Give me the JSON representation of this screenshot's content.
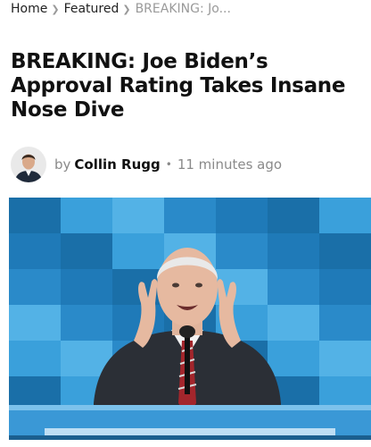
{
  "breadcrumb": {
    "items": [
      {
        "label": "Home"
      },
      {
        "label": "Featured"
      }
    ],
    "current": "BREAKING: Jo..."
  },
  "article": {
    "title": "BREAKING: Joe Biden’s Approval Rating Takes Insane Nose Dive",
    "byline": {
      "by": "by",
      "author": "Collin Rugg",
      "separator": "•",
      "time": "11 minutes ago"
    }
  },
  "colors": {
    "text": "#111111",
    "muted": "#8a8a8a",
    "backdrop_blue": "#1d78b3"
  }
}
